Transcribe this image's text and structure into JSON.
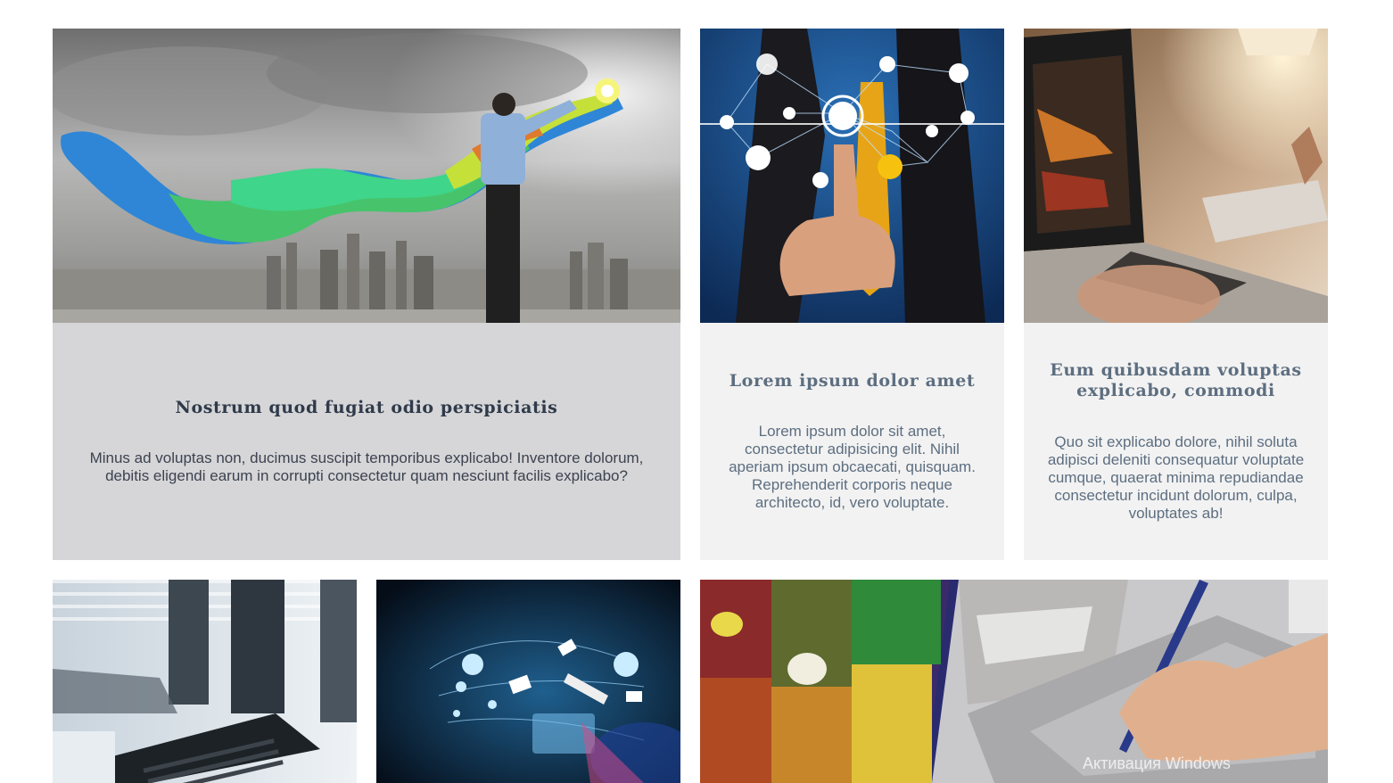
{
  "cards": [
    {
      "title": "Nostrum quod fugiat odio perspiciatis",
      "body": "Minus ad voluptas non, ducimus suscipit temporibus explicabo! Inventore dolorum, debitis eligendi earum in corrupti consectetur quam nesciunt facilis explicabo?"
    },
    {
      "title": "Lorem ipsum dolor amet",
      "body": "Lorem ipsum dolor sit amet, consectetur adipisicing elit. Nihil aperiam ipsum obcaecati, quisquam. Reprehenderit corporis neque architecto, id, vero voluptate."
    },
    {
      "title": "Eum quibusdam voluptas explicabo, commodi",
      "body": "Quo sit explicabo dolore, nihil soluta adipisci deleniti consequatur voluptate cumque, quaerat minima repudiandae consectetur incidunt dolorum, culpa, voluptates ab!"
    }
  ],
  "watermark": "Активация Windows"
}
